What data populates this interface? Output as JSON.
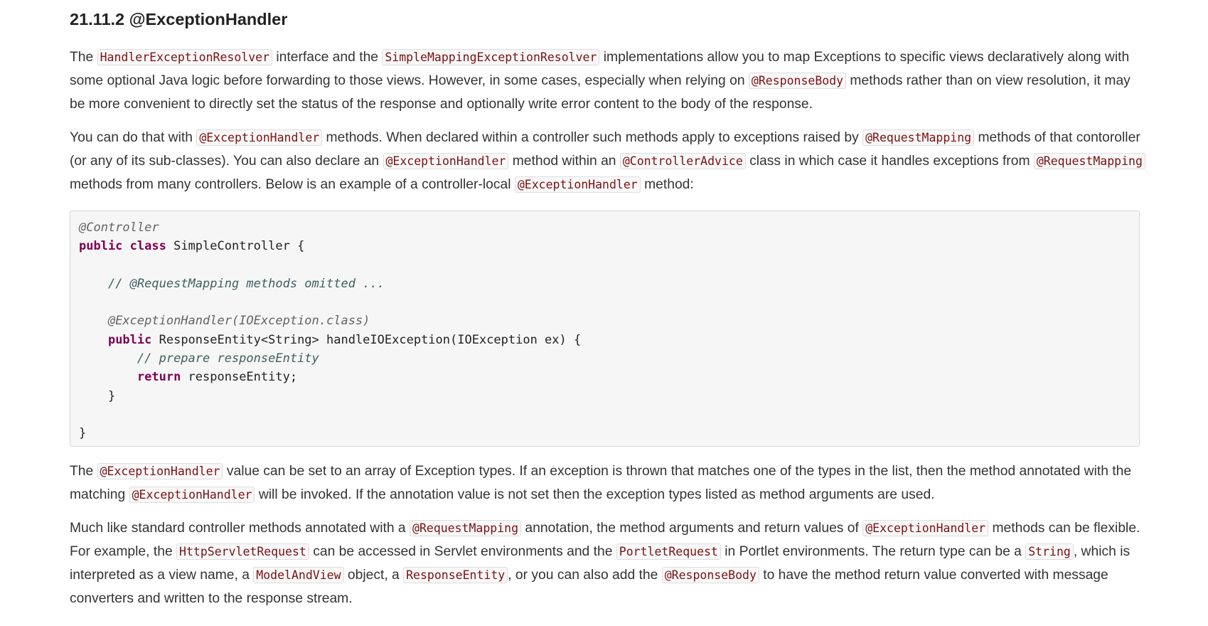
{
  "heading": "21.11.2 @ExceptionHandler",
  "para1": {
    "t1": "The ",
    "c1": "HandlerExceptionResolver",
    "t2": " interface and the ",
    "c2": "SimpleMappingExceptionResolver",
    "t3": " implementations allow you to map Exceptions to specific views declaratively along with some optional Java logic before forwarding to those views. However, in some cases, especially when relying on ",
    "c3": "@ResponseBody",
    "t4": " methods rather than on view resolution, it may be more convenient to directly set the status of the response and optionally write error content to the body of the response."
  },
  "para2": {
    "t1": "You can do that with ",
    "c1": "@ExceptionHandler",
    "t2": " methods. When declared within a controller such methods apply to exceptions raised by ",
    "c2": "@RequestMapping",
    "t3": " methods of that contoroller (or any of its sub-classes). You can also declare an ",
    "c3": "@ExceptionHandler",
    "t4": " method within an ",
    "c4": "@ControllerAdvice",
    "t5": " class in which case it handles exceptions from ",
    "c5": "@RequestMapping",
    "t6": " methods from many controllers. Below is an example of a controller-local ",
    "c6": "@ExceptionHandler",
    "t7": " method:"
  },
  "code": {
    "l1_ann": "@Controller",
    "l2_kw1": "public",
    "l2_kw2": "class",
    "l2_rest": " SimpleController {",
    "l4_com": "// @RequestMapping methods omitted ...",
    "l6_ann": "@ExceptionHandler(IOException.class)",
    "l7_kw": "public",
    "l7_rest": " ResponseEntity<String> handleIOException(IOException ex) {",
    "l8_com": "// prepare responseEntity",
    "l9_kw": "return",
    "l9_rest": " responseEntity;",
    "l10": "}",
    "l12": "}"
  },
  "para3": {
    "t1": "The ",
    "c1": "@ExceptionHandler",
    "t2": " value can be set to an array of Exception types. If an exception is thrown that matches one of the types in the list, then the method annotated with the matching ",
    "c2": "@ExceptionHandler",
    "t3": " will be invoked. If the annotation value is not set then the exception types listed as method arguments are used."
  },
  "para4": {
    "t1": "Much like standard controller methods annotated with a ",
    "c1": "@RequestMapping",
    "t2": " annotation, the method arguments and return values of ",
    "c2": "@ExceptionHandler",
    "t3": " methods can be flexible. For example, the ",
    "c3": "HttpServletRequest",
    "t4": " can be accessed in Servlet environments and the ",
    "c4": "PortletRequest",
    "t5": " in Portlet environments. The return type can be a ",
    "c5": "String",
    "t6": ", which is interpreted as a view name, a ",
    "c6": "ModelAndView",
    "t7": " object, a ",
    "c7": "ResponseEntity",
    "t8": ", or you can also add the ",
    "c8": "@ResponseBody",
    "t9": " to have the method return value converted with message converters and written to the response stream."
  }
}
